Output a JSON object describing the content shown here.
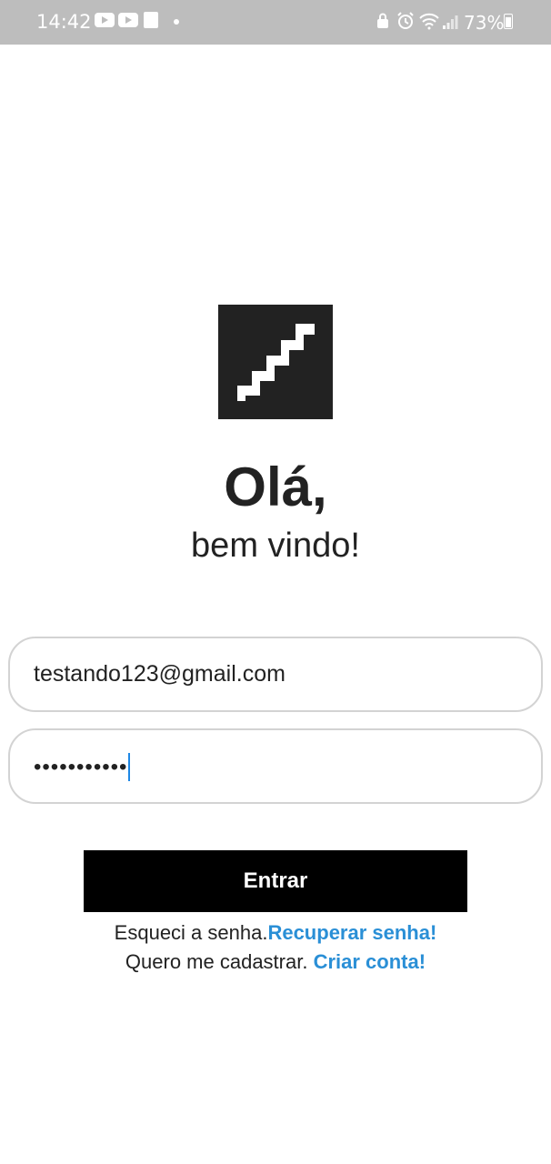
{
  "status_bar": {
    "time": "14:42",
    "battery": "73%",
    "icons": [
      "youtube-icon",
      "youtube-icon",
      "shopping-bag-icon",
      "dot-icon",
      "lock-icon",
      "alarm-icon",
      "wifi-icon",
      "signal-icon",
      "battery-icon"
    ]
  },
  "logo": {
    "icon": "stairs-icon",
    "colors": {
      "background": "#222222",
      "foreground": "#ffffff"
    }
  },
  "header": {
    "title": "Olá,",
    "subtitle": "bem vindo!"
  },
  "form": {
    "email_value": "testando123@gmail.com",
    "password_masked": "•••••••••••",
    "submit_label": "Entrar"
  },
  "links": {
    "forgot_text": "Esqueci a senha.",
    "forgot_link": "Recuperar senha!",
    "signup_text": "Quero me cadastrar. ",
    "signup_link": "Criar conta!"
  },
  "colors": {
    "accent": "#2a8fd6",
    "button": "#000000",
    "status_bar": "#bdbdbd"
  }
}
